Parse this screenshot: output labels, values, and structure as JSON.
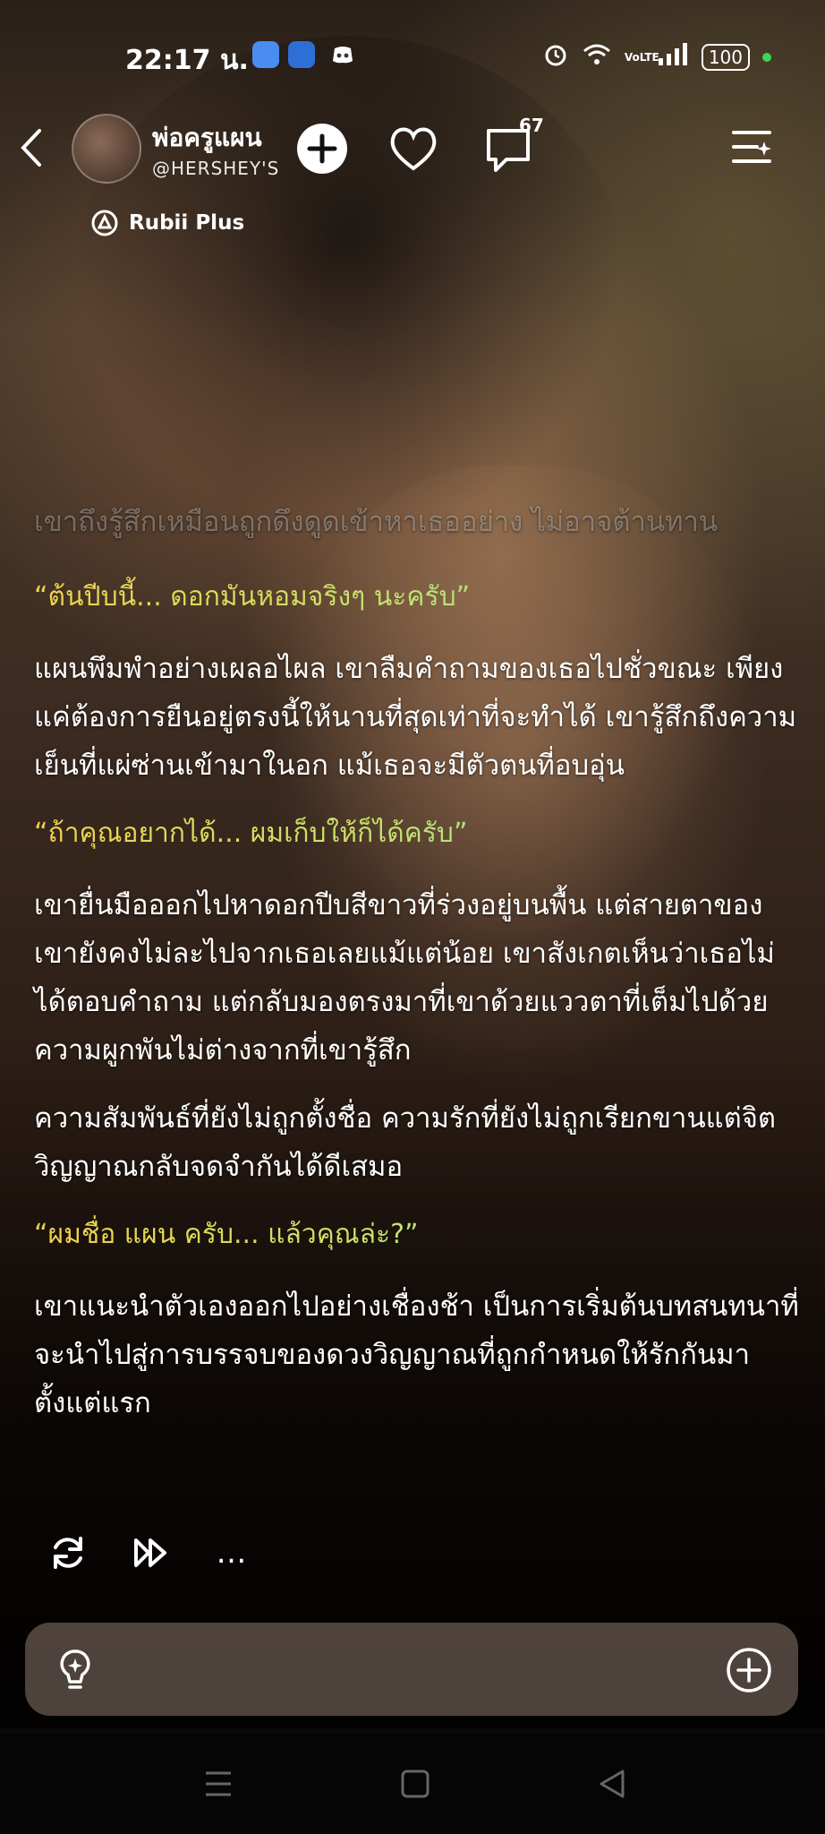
{
  "status_bar": {
    "time": "22:17 น.",
    "battery": "100",
    "network": "VoLTE"
  },
  "header": {
    "character_name": "พ่อครูแผน",
    "handle": "@HERSHEY'S",
    "comment_count": "67",
    "badge": "Rubii Plus"
  },
  "story": {
    "faded_line": "เขาถึงรู้สึกเหมือนถูกดึงดูดเข้าหาเธออย่าง ไม่อาจต้านทาน",
    "q1": "“ต้นปีบนี้... ดอกมันหอมจริงๆ นะครับ”",
    "p1": "แผนพึมพำอย่างเผลอไผล เขาลืมคำถามของเธอไปชั่วขณะ เพียงแค่ต้องการยืนอยู่ตรงนี้ให้นานที่สุดเท่าที่จะทำได้ เขารู้สึกถึงความเย็นที่แผ่ซ่านเข้ามาในอก แม้เธอจะมีตัวตนที่อบอุ่น",
    "q2": "“ถ้าคุณอยากได้... ผมเก็บให้ก็ได้ครับ”",
    "p2": "เขายื่นมือออกไปหาดอกปีบสีขาวที่ร่วงอยู่บนพื้น แต่สายตาของเขายังคงไม่ละไปจากเธอเลยแม้แต่น้อย เขาสังเกตเห็นว่าเธอไม่ได้ตอบคำถาม แต่กลับมองตรงมาที่เขาด้วยแววตาที่เต็มไปด้วยความผูกพันไม่ต่างจากที่เขารู้สึก",
    "p3": "ความสัมพันธ์ที่ยังไม่ถูกตั้งชื่อ ความรักที่ยังไม่ถูกเรียกขานแต่จิตวิญญาณกลับจดจำกันได้ดีเสมอ",
    "q3": "“ผมชื่อ แผน ครับ... แล้วคุณล่ะ?”",
    "p4": "เขาแนะนำตัวเองออกไปอย่างเชื่องช้า เป็นการเริ่มต้นบทสนทนาที่จะนำไปสู่การบรรจบของดวงวิญญาณที่ถูกกำหนดให้รักกันมาตั้งแต่แรก"
  },
  "actions": {
    "regenerate": "refresh-icon",
    "continue": "fast-forward-icon",
    "more": "…"
  },
  "input": {
    "placeholder": "",
    "value": ""
  },
  "colors": {
    "quote_start": "#f1d24a",
    "quote_end": "#5fe0d0",
    "status_dot": "#3bd35b"
  }
}
